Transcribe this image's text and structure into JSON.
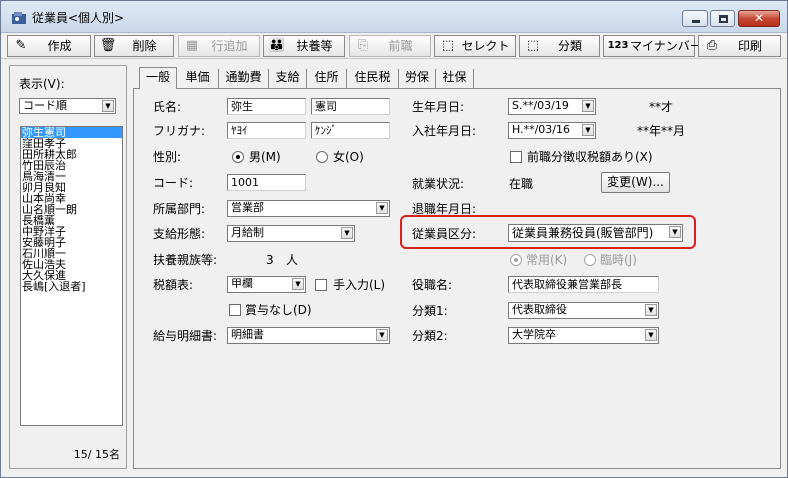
{
  "window": {
    "title": "従業員<個人別>",
    "close_glyph": "✕"
  },
  "toolbar": {
    "buttons": [
      {
        "label": "作成",
        "icon": "edit-icon",
        "glyph": "✎"
      },
      {
        "label": "削除",
        "icon": "trash-icon",
        "glyph": "🗑"
      },
      {
        "label": "行追加",
        "icon": "table-add-icon",
        "glyph": "▦",
        "disabled": true
      },
      {
        "label": "扶養等",
        "icon": "family-icon",
        "glyph": "👪"
      },
      {
        "label": "前職",
        "icon": "copy-icon",
        "glyph": "⎘",
        "disabled": true
      },
      {
        "label": "セレクト",
        "icon": "select-icon",
        "glyph": "⬚"
      },
      {
        "label": "分類",
        "icon": "classify-icon",
        "glyph": "⬚"
      },
      {
        "label": "マイナンバー",
        "icon": "mynumber-icon",
        "glyph": "123"
      },
      {
        "label": "印刷",
        "icon": "printer-icon",
        "glyph": "⎙"
      }
    ]
  },
  "left_panel": {
    "display_label": "表示(V):",
    "sort_value": "コード順",
    "employees": [
      "弥生憲司",
      "窪田孝子",
      "田所耕太郎",
      "竹田辰治",
      "鳥海清一",
      "卯月良知",
      "山本尚幸",
      "山名順一朗",
      "長橋薫",
      "中野洋子",
      "安藤明子",
      "石川順一",
      "佐山浩夫",
      "大久保進",
      "長嶋[入退者]"
    ],
    "selected_index": 0,
    "count_text": "15/  15名"
  },
  "tabs": [
    "一般",
    "単価",
    "通勤費",
    "支給",
    "住所",
    "住民税",
    "労保",
    "社保"
  ],
  "active_tab": 0,
  "form": {
    "name_label": "氏名:",
    "last_name": "弥生",
    "first_name": "憲司",
    "kana_label": "フリガナ:",
    "last_kana": "ﾔﾖｲ",
    "first_kana": "ｹﾝｼﾞ",
    "gender_label": "性別:",
    "gender_male": "男(M)",
    "gender_female": "女(O)",
    "gender_selected": "male",
    "code_label": "コード:",
    "code_value": "1001",
    "dept_label": "所属部門:",
    "dept_value": "営業部",
    "paytype_label": "支給形態:",
    "paytype_value": "月給制",
    "dependents_label": "扶養親族等:",
    "dependents_count": "3",
    "dependents_unit": "人",
    "taxtable_label": "税額表:",
    "taxtable_value": "甲欄",
    "manual_input_label": "手入力(L)",
    "no_bonus_label": "賞与なし(D)",
    "payslip_label": "給与明細書:",
    "payslip_value": "明細書",
    "birth_label": "生年月日:",
    "birth_value": "S.**/03/19",
    "age_text": "**才",
    "hire_label": "入社年月日:",
    "hire_value": "H.**/03/16",
    "tenure_text": "**年**月",
    "prev_job_label": "前職分徴収税額あり(X)",
    "status_label": "就業状況:",
    "status_value": "在職",
    "change_button": "変更(W)...",
    "retire_label": "退職年月日:",
    "emptype_label": "従業員区分:",
    "emptype_value": "従業員兼務役員(販管部門)",
    "regular_label": "常用(K)",
    "temp_label": "臨時(J)",
    "title_label": "役職名:",
    "title_value": "代表取締役兼営業部長",
    "class1_label": "分類1:",
    "class1_value": "代表取締役",
    "class2_label": "分類2:",
    "class2_value": "大学院卒"
  }
}
